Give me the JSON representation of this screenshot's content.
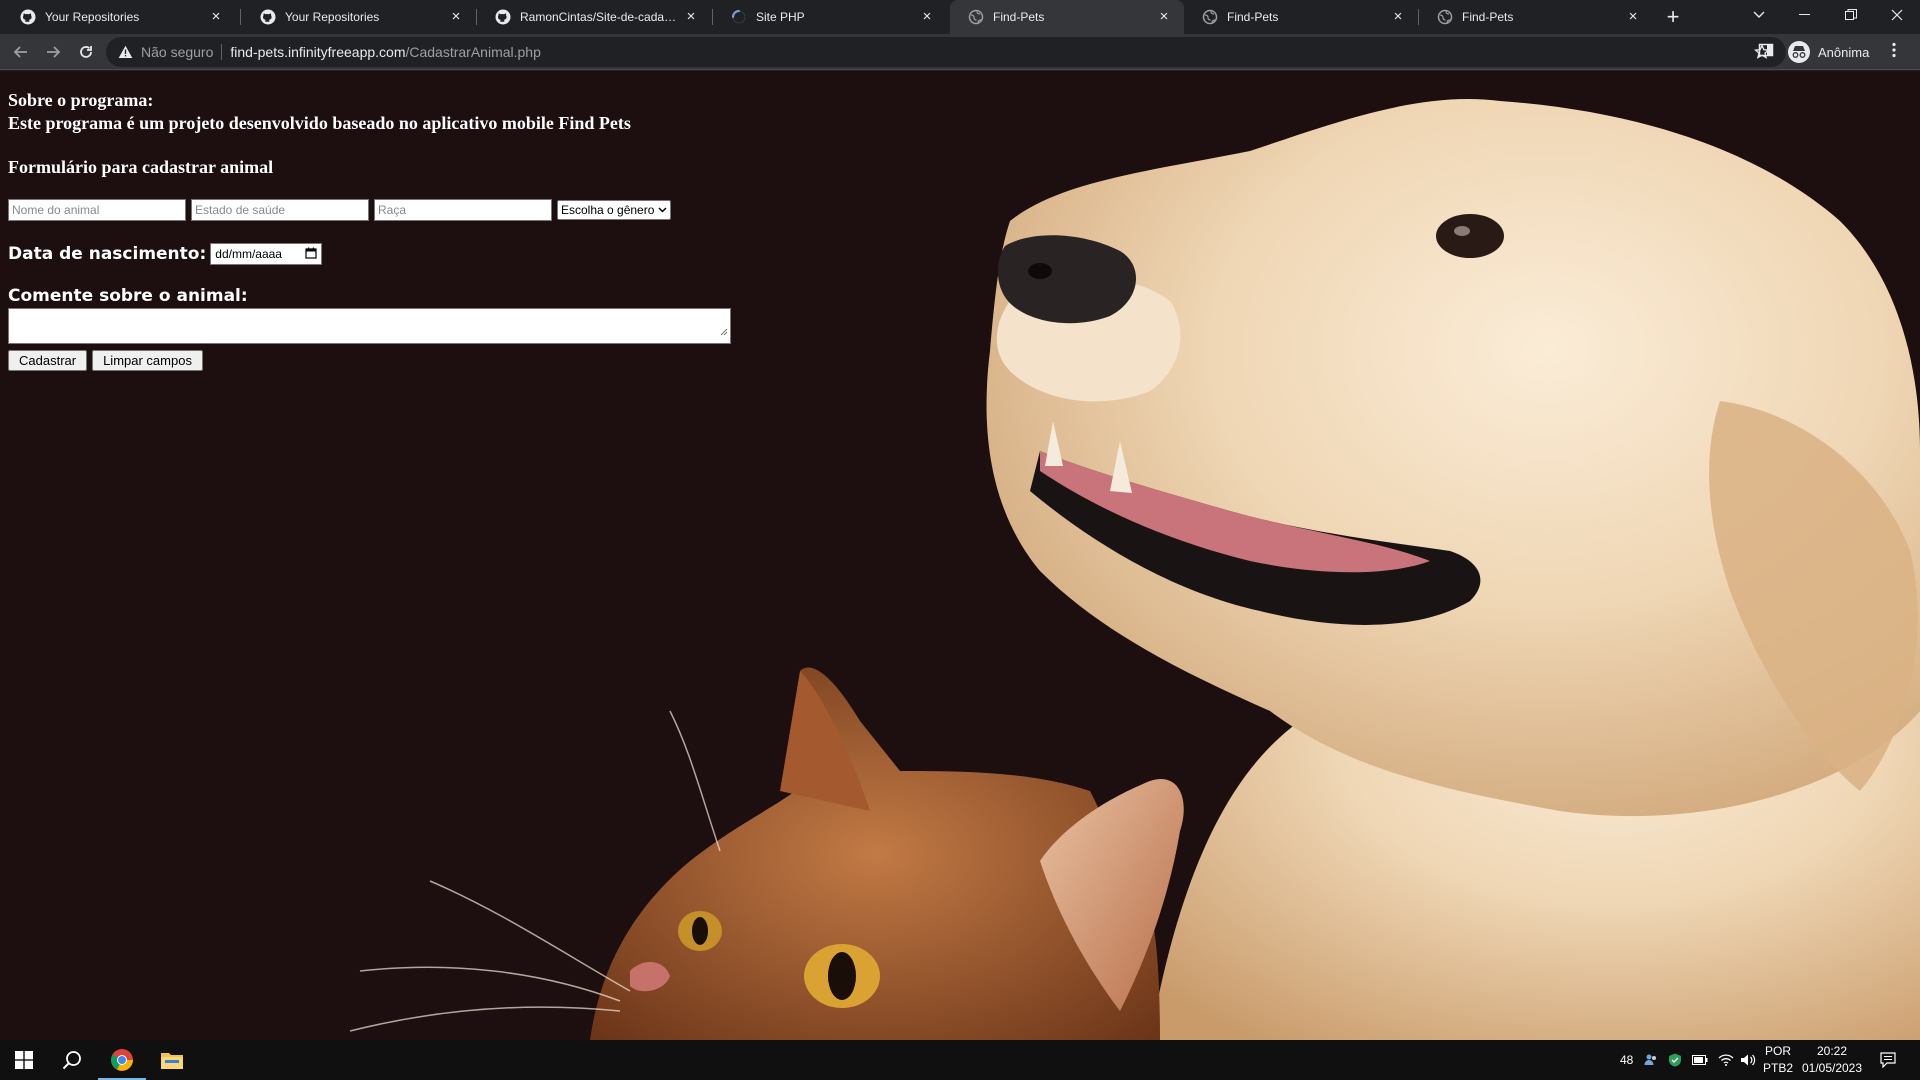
{
  "browser": {
    "tabs": [
      {
        "title": "Your Repositories",
        "favicon": "github-icon",
        "active": false
      },
      {
        "title": "Your Repositories",
        "favicon": "github-icon",
        "active": false
      },
      {
        "title": "RamonCintas/Site-de-cadastro-",
        "favicon": "github-icon",
        "active": false
      },
      {
        "title": "Site PHP",
        "favicon": "loading-spinner-icon",
        "active": false
      },
      {
        "title": "Find-Pets",
        "favicon": "globe-icon",
        "active": true
      },
      {
        "title": "Find-Pets",
        "favicon": "globe-icon",
        "active": false
      },
      {
        "title": "Find-Pets",
        "favicon": "globe-icon",
        "active": false
      }
    ],
    "tab_close_glyph": "×",
    "new_tab_glyph": "+",
    "address": {
      "security_label": "Não seguro",
      "host": "find-pets.infinityfreeapp.com",
      "path": "/CadastrarAnimal.php"
    },
    "profile_label": "Anônima"
  },
  "page": {
    "about_heading": "Sobre o programa:",
    "about_text": "Este programa é um projeto desenvolvido baseado no aplicativo mobile Find Pets",
    "form_title": "Formulário para cadastrar animal",
    "fields": {
      "name_placeholder": "Nome do animal",
      "health_placeholder": "Estado de saúde",
      "breed_placeholder": "Raça",
      "gender_select_value": "Escolha o gênero"
    },
    "birth_label": "Data de nascimento:",
    "birth_placeholder": "dd/mm/aaaa",
    "comment_label": "Comente sobre o animal:",
    "buttons": {
      "submit": "Cadastrar",
      "clear": "Limpar campos"
    },
    "background_image": "golden-retriever-and-cat-photo"
  },
  "taskbar": {
    "pinned": [
      "windows-start-icon",
      "search-icon",
      "chrome-icon",
      "file-explorer-icon"
    ],
    "tray_number": "48",
    "language_line1": "POR",
    "language_line2": "PTB2",
    "time": "20:22",
    "date": "01/05/2023"
  },
  "colors": {
    "titlebar": "#202124",
    "toolbar": "#35363a",
    "page_background": "#1d0e10",
    "text": "#ffffff",
    "taskbar": "#101010"
  }
}
